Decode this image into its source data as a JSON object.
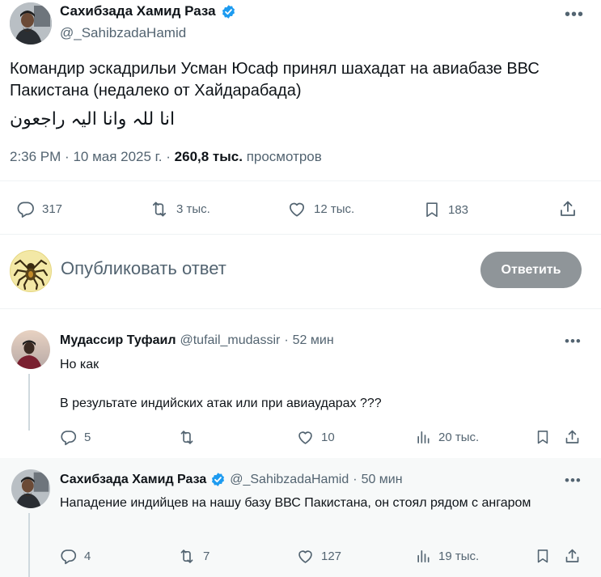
{
  "main_tweet": {
    "author_name": "Сахибзада Хамид Раза",
    "author_handle": "@_SahibzadaHamid",
    "text": "Командир эскадрильи Усман Юсаф принял шахадат на авиабазе ВВС Пакистана (недалеко от Хайдарабада)",
    "arabic_text": "انا للہ وانا الیہ راجعون",
    "time": "2:36 PM",
    "date": "10 мая 2025 г.",
    "views_count": "260,8 тыс.",
    "views_label": "просмотров",
    "stats": {
      "replies": "317",
      "reposts": "3 тыс.",
      "likes": "12 тыс.",
      "bookmarks": "183"
    }
  },
  "compose": {
    "placeholder": "Опубликовать ответ",
    "button_label": "Ответить"
  },
  "replies": [
    {
      "author_name": "Мудассир Туфаил",
      "author_handle": "@tufail_mudassir",
      "time": "52 мин",
      "line1": "Но как",
      "line2": "В результате индийских атак или при авиаударах ???",
      "stats": {
        "replies": "5",
        "reposts": "",
        "likes": "10",
        "views": "20 тыс."
      }
    },
    {
      "author_name": "Сахибзада Хамид Раза",
      "author_handle": "@_SahibzadaHamid",
      "time": "50 мин",
      "line1": "Нападение индийцев на нашу базу ВВС Пакистана, он стоял рядом с ангаром",
      "stats": {
        "replies": "4",
        "reposts": "7",
        "likes": "127",
        "views": "19 тыс."
      }
    }
  ],
  "colors": {
    "text": "#0f1419",
    "secondary": "#536471",
    "verified": "#1d9bf0",
    "button_disabled": "#8f9599",
    "divider": "#eff3f4"
  }
}
